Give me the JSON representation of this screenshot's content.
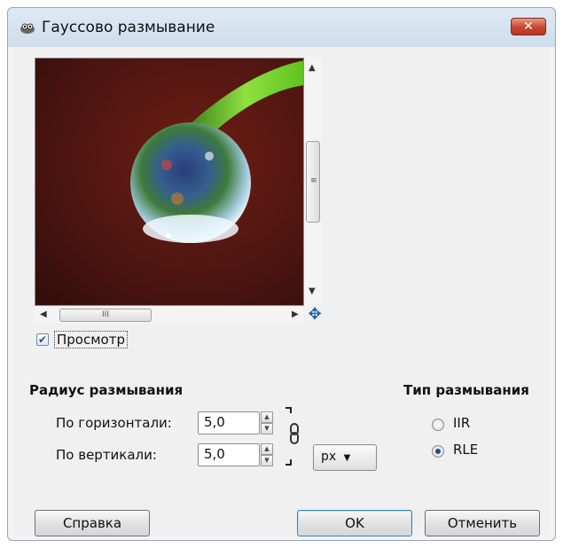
{
  "window": {
    "title": "Гауссово размывание",
    "close_label": "✕"
  },
  "preview": {
    "checkbox_label": "Просмотр",
    "checked": true
  },
  "radius": {
    "section_title": "Радиус размывания",
    "horizontal_label": "По горизонтали:",
    "horizontal_value": "5,0",
    "vertical_label": "По вертикали:",
    "vertical_value": "5,0",
    "unit": "px"
  },
  "blur_type": {
    "section_title": "Тип размывания",
    "options": [
      {
        "label": "IIR",
        "selected": false
      },
      {
        "label": "RLE",
        "selected": true
      }
    ]
  },
  "buttons": {
    "help": "Справка",
    "ok": "OK",
    "cancel": "Отменить"
  }
}
